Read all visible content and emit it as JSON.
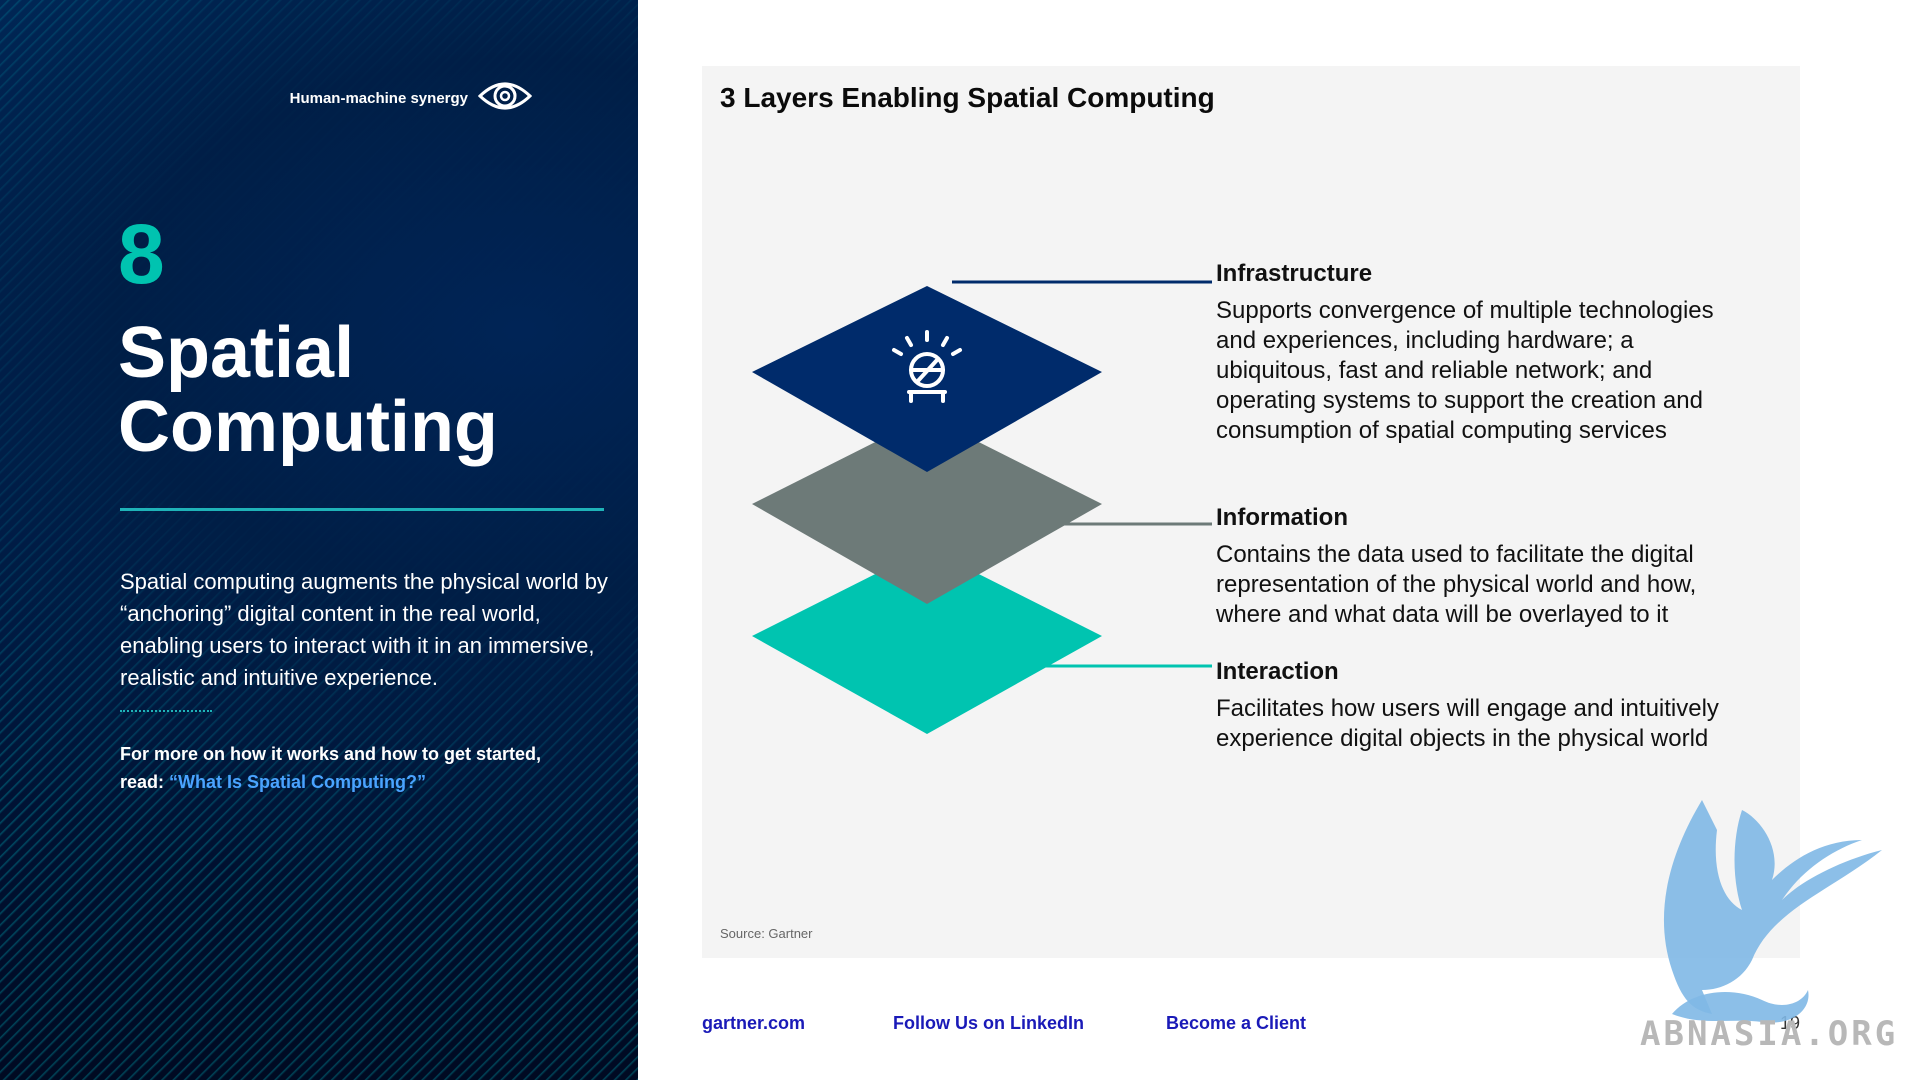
{
  "sidebar": {
    "eyebrow": "Human-machine synergy",
    "eyebrow_icon": "eye-icon",
    "number": "8",
    "title_line1": "Spatial",
    "title_line2": "Computing",
    "description": "Spatial computing augments the physical world by “anchoring” digital content in the real world, enabling users to interact with it in an immersive, realistic and intuitive experience.",
    "more_text": "For more on how it works and how to get started, read: ",
    "more_link": "“What Is Spatial Computing?”"
  },
  "panel": {
    "title": "3 Layers Enabling Spatial Computing",
    "source": "Source: Gartner",
    "layers": [
      {
        "name": "Infrastructure",
        "description": "Supports convergence of multiple technologies and experiences, including hardware; a ubiquitous, fast and reliable network; and operating systems to support the creation and consumption of spatial computing services",
        "color": "#002b6b"
      },
      {
        "name": "Information",
        "description": "Contains the data used to facilitate the digital representation of the physical world and how, where and what data will be overlayed to it",
        "color": "#6d7a78"
      },
      {
        "name": "Interaction",
        "description": "Facilitates how users will engage and intuitively experience digital objects in the physical world",
        "color": "#00c4b0"
      }
    ]
  },
  "footer": {
    "links": [
      "gartner.com",
      "Follow Us on LinkedIn",
      "Become a Client"
    ],
    "page_number": "19"
  },
  "watermark": {
    "text": "ABNASIA.ORG"
  },
  "colors": {
    "accent_teal": "#00c3b0",
    "navy": "#002b6b",
    "link_blue": "#4aa3ff",
    "footer_link": "#1a1ab8"
  }
}
